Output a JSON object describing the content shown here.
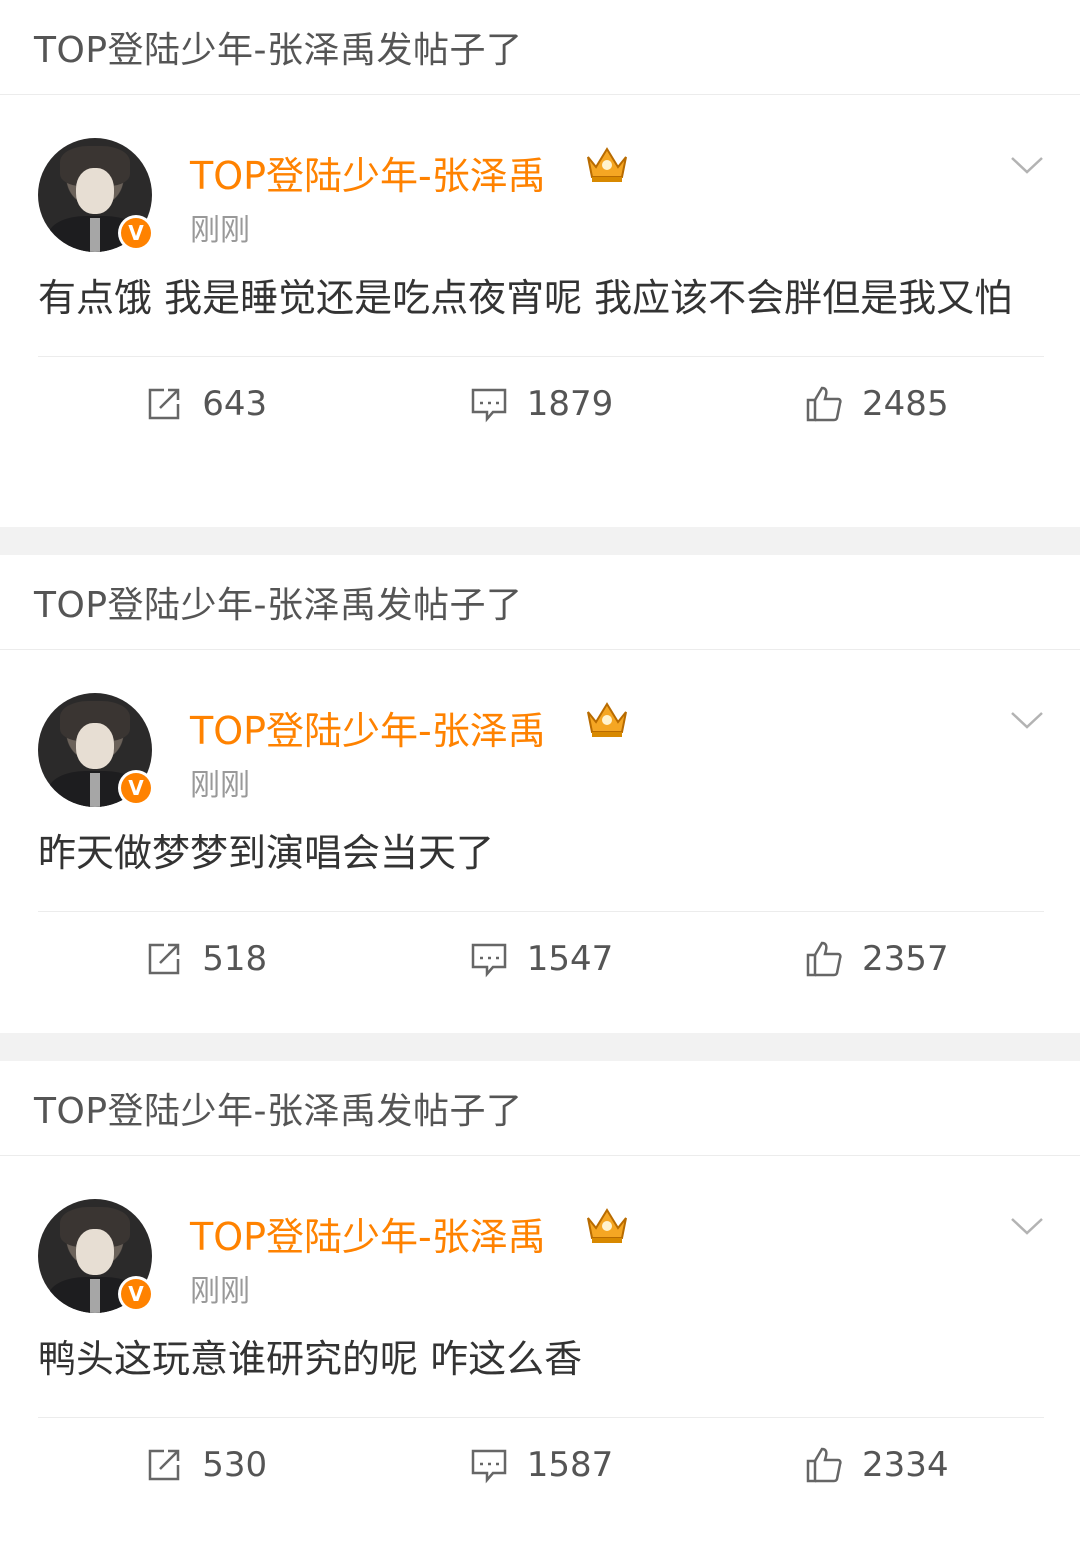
{
  "posts": [
    {
      "header": "TOP登陆少年-张泽禹发帖子了",
      "author": "TOP登陆少年-张泽禹",
      "time": "刚刚",
      "verified_badge": "V",
      "text": "有点饿 我是睡觉还是吃点夜宵呢 我应该不会胖但是我又怕",
      "reposts": "643",
      "comments": "1879",
      "likes": "2485"
    },
    {
      "header": "TOP登陆少年-张泽禹发帖子了",
      "author": "TOP登陆少年-张泽禹",
      "time": "刚刚",
      "verified_badge": "V",
      "text": "昨天做梦梦到演唱会当天了",
      "reposts": "518",
      "comments": "1547",
      "likes": "2357"
    },
    {
      "header": "TOP登陆少年-张泽禹发帖子了",
      "author": "TOP登陆少年-张泽禹",
      "time": "刚刚",
      "verified_badge": "V",
      "text": "鸭头这玩意谁研究的呢 咋这么香",
      "reposts": "530",
      "comments": "1587",
      "likes": "2334"
    }
  ],
  "icons": {
    "repost": "repost-icon",
    "comment": "comment-icon",
    "like": "like-icon",
    "crown": "crown-icon",
    "chevron": "chevron-down-icon"
  },
  "colors": {
    "author_name": "#ff8200",
    "verified_badge": "#ff8200",
    "crown": "#f5a623"
  }
}
